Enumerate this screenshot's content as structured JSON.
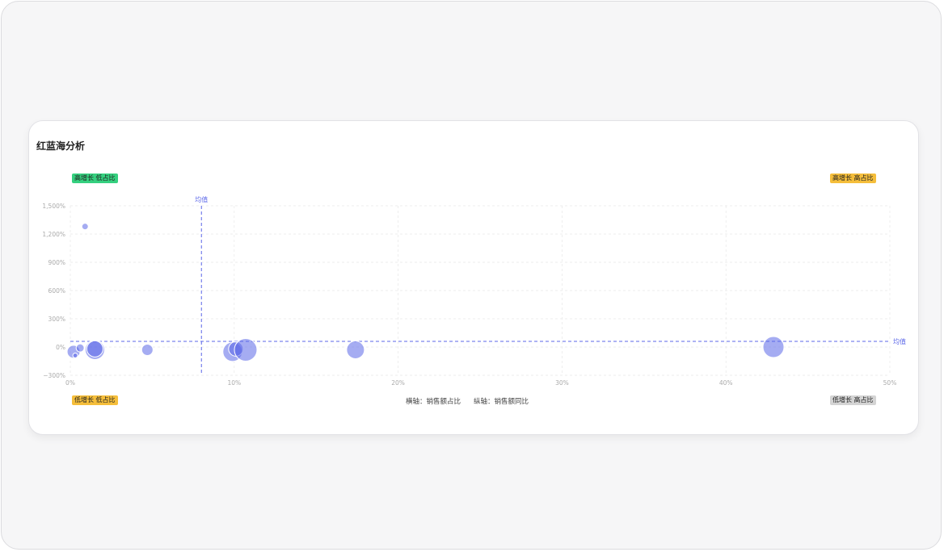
{
  "card": {
    "title": "红蓝海分析",
    "quadrants": {
      "top_left": "高增长 低占比",
      "top_right": "高增长 高占比",
      "bottom_left": "低增长 低占比",
      "bottom_right": "低增长 高占比"
    },
    "axis_note": {
      "x": "横轴：销售额占比",
      "y": "纵轴：销售额同比"
    }
  },
  "colors": {
    "green": "#35d07f",
    "yellow": "#f5be3b",
    "gray": "#d4d4d4",
    "bubble": "#5b67e8",
    "mean_line": "#5b67e8",
    "grid": "#e8e8e8"
  },
  "chart_data": {
    "type": "scatter",
    "xlim": [
      0,
      50
    ],
    "ylim": [
      -300,
      1500
    ],
    "x_ticks": [
      0,
      10,
      20,
      30,
      40,
      50
    ],
    "y_ticks": [
      -300,
      0,
      300,
      600,
      900,
      1200,
      1500
    ],
    "x_tick_labels": [
      "0%",
      "10%",
      "20%",
      "30%",
      "40%",
      "50%"
    ],
    "y_tick_labels": [
      "−300%",
      "0%",
      "300%",
      "600%",
      "900%",
      "1,200%",
      "1,500%"
    ],
    "mean_label": "均值",
    "mean_x": 8,
    "mean_y": 60,
    "grid": true,
    "points": [
      {
        "x": 0.9,
        "y": 1280,
        "r": 4
      },
      {
        "x": 0.2,
        "y": -50,
        "r": 8
      },
      {
        "x": 0.3,
        "y": -90,
        "r": 3
      },
      {
        "x": 0.6,
        "y": -10,
        "r": 5
      },
      {
        "x": 1.5,
        "y": -30,
        "r": 12
      },
      {
        "x": 1.5,
        "y": -20,
        "r": 10
      },
      {
        "x": 4.7,
        "y": -30,
        "r": 7
      },
      {
        "x": 9.9,
        "y": -50,
        "r": 12
      },
      {
        "x": 10.1,
        "y": -20,
        "r": 9
      },
      {
        "x": 10.7,
        "y": -30,
        "r": 14
      },
      {
        "x": 17.4,
        "y": -30,
        "r": 11
      },
      {
        "x": 42.9,
        "y": 0,
        "r": 13
      }
    ]
  }
}
